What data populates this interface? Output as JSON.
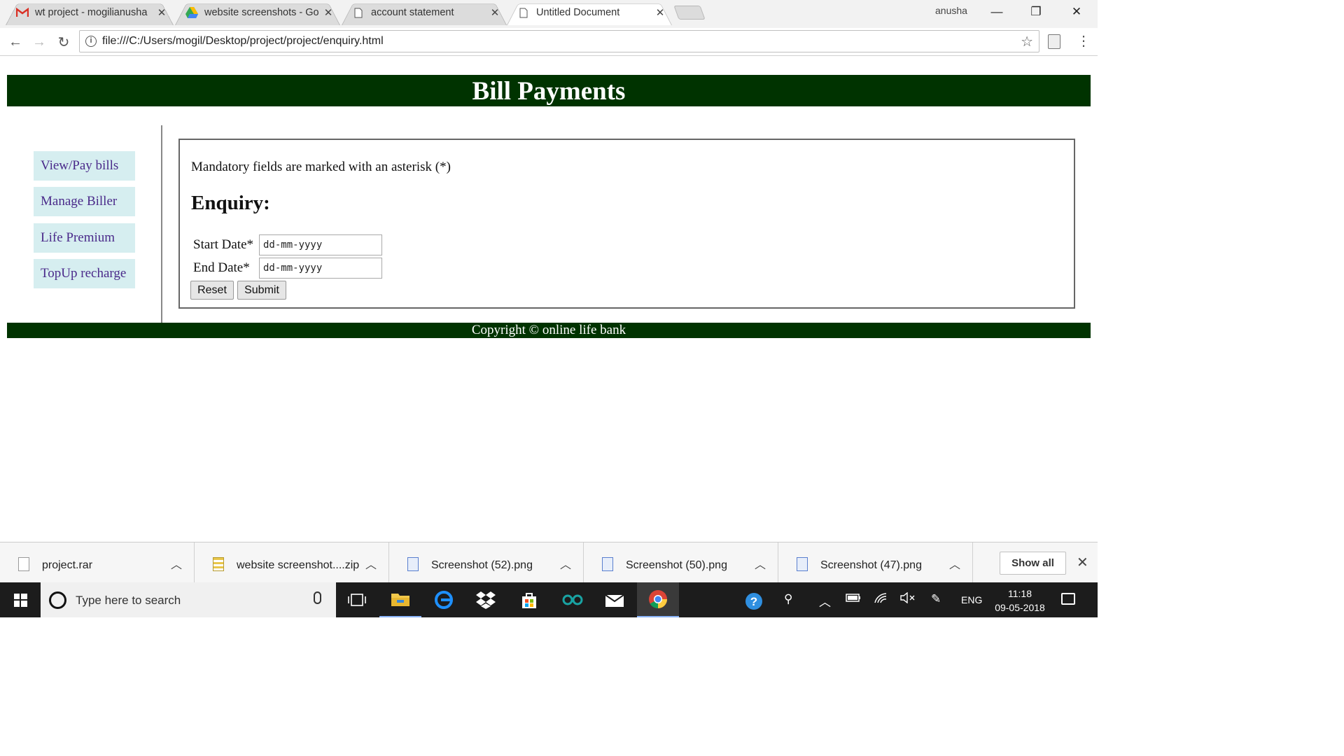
{
  "browser": {
    "tabs": [
      {
        "title": "wt project - mogilianusha",
        "icon": "gmail-icon"
      },
      {
        "title": "website screenshots - Go",
        "icon": "google-drive-icon"
      },
      {
        "title": "account statement",
        "icon": "page-icon"
      },
      {
        "title": "Untitled Document",
        "icon": "page-icon",
        "active": true
      }
    ],
    "profile_name": "anusha",
    "url": "file:///C:/Users/mogil/Desktop/project/project/enquiry.html"
  },
  "page": {
    "banner_title": "Bill Payments",
    "sidebar": [
      {
        "label": "View/Pay bills"
      },
      {
        "label": "Manage Biller"
      },
      {
        "label": "Life Premium"
      },
      {
        "label": "TopUp recharge"
      }
    ],
    "form": {
      "mandatory_note": "Mandatory fields are marked with an asterisk (*)",
      "heading": "Enquiry:",
      "start_label": "Start Date*",
      "start_placeholder": "dd-mm-yyyy",
      "end_label": "End Date*",
      "end_placeholder": "dd-mm-yyyy",
      "reset_label": "Reset",
      "submit_label": "Submit"
    },
    "footer": "Copyright © online life bank",
    "colors": {
      "banner_bg": "#003300",
      "sidebar_bg": "#d6eef0",
      "sidebar_text": "#4a2a8a"
    }
  },
  "downloads": {
    "items": [
      {
        "name": "project.rar",
        "icon": "file-icon"
      },
      {
        "name": "website screenshot....zip",
        "icon": "zip-icon"
      },
      {
        "name": "Screenshot (52).png",
        "icon": "image-icon"
      },
      {
        "name": "Screenshot (50).png",
        "icon": "image-icon"
      },
      {
        "name": "Screenshot (47).png",
        "icon": "image-icon"
      }
    ],
    "show_all_label": "Show all"
  },
  "taskbar": {
    "search_placeholder": "Type here to search",
    "language": "ENG",
    "time": "11:18",
    "date": "09-05-2018"
  }
}
